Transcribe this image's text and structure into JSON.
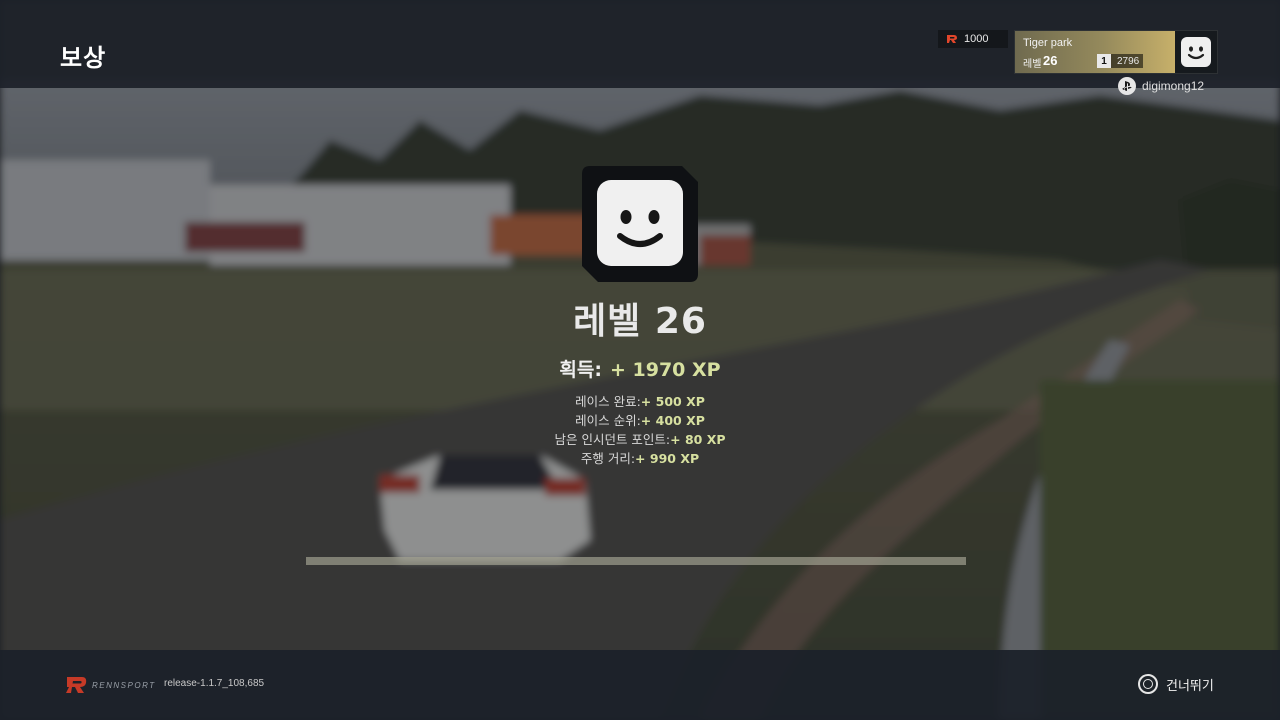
{
  "header": {
    "title": "보상",
    "currency": {
      "value": "1000",
      "icon": "rennsport-r-icon",
      "color": "#e2462b"
    },
    "profile": {
      "name": "Tiger park",
      "level_label": "레벨",
      "level_value": "26",
      "rank_icon_text": "1",
      "rank_value": "2796",
      "avatar": "smiley-avatar-icon"
    },
    "psn": {
      "icon": "playstation-icon",
      "username": "digimong12"
    }
  },
  "reward": {
    "avatar": "smiley-avatar-icon",
    "level_title": "레벨 26",
    "gain_label": "획득:",
    "gain_value": "+ 1970 XP",
    "breakdown": [
      {
        "label": "레이스 완료:",
        "value": "+ 500 XP"
      },
      {
        "label": "레이스 순위:",
        "value": "+ 400 XP"
      },
      {
        "label": "남은 인시던트 포인트:",
        "value": "+ 80 XP"
      },
      {
        "label": "주행 거리:",
        "value": "+ 990 XP"
      }
    ],
    "progress_fraction": 1.0,
    "accent_color": "#d7e0a0"
  },
  "footer": {
    "logo_text": "RENNSPORT",
    "version": "release-1.1.7_108,685",
    "skip_icon": "circle-button-icon",
    "skip_label": "건너뛰기"
  }
}
